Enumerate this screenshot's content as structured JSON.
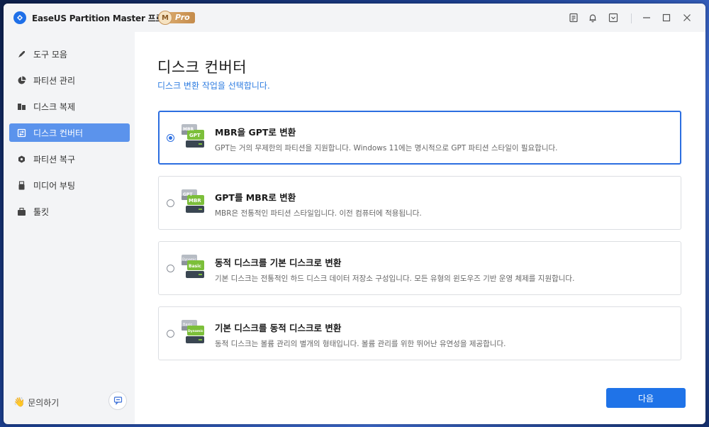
{
  "app": {
    "title": "EaseUS Partition Master 프로 버전",
    "badge_letter": "M",
    "badge_label": "Pro"
  },
  "titlebar_icons": [
    "notes-icon",
    "bell-icon",
    "dropdown-icon",
    "minimize-icon",
    "maximize-icon",
    "close-icon"
  ],
  "sidebar": {
    "items": [
      {
        "label": "도구 모음",
        "icon": "rocket-icon",
        "active": false
      },
      {
        "label": "파티션 관리",
        "icon": "pie-chart-icon",
        "active": false
      },
      {
        "label": "디스크 복제",
        "icon": "clone-icon",
        "active": false
      },
      {
        "label": "디스크 컨버터",
        "icon": "convert-icon",
        "active": true
      },
      {
        "label": "파티션 복구",
        "icon": "recovery-icon",
        "active": false
      },
      {
        "label": "미디어 부팅",
        "icon": "usb-icon",
        "active": false
      },
      {
        "label": "툴킷",
        "icon": "toolkit-icon",
        "active": false
      }
    ],
    "help_label": "문의하기"
  },
  "main": {
    "title": "디스크 컨버터",
    "subtitle": "디스크 변환 작업을 선택합니다.",
    "options": [
      {
        "title": "MBR을 GPT로 변환",
        "description": "GPT는 거의 무제한의 파티션을 지원합니다. Windows 11에는 명시적으로 GPT 파티션 스타일이 필요합니다.",
        "icon_top": "MBR",
        "icon_bottom": "GPT",
        "selected": true
      },
      {
        "title": "GPT를 MBR로 변환",
        "description": "MBR은 전통적인 파티션 스타일입니다. 이전 컴퓨터에 적용됩니다.",
        "icon_top": "GPT",
        "icon_bottom": "MBR",
        "selected": false
      },
      {
        "title": "동적 디스크를 기본 디스크로 변환",
        "description": "기본 디스크는 전통적인 하드 디스크 데이터 저장소 구성입니다. 모든 유형의 윈도우즈 기반 운영 체제를 지원합니다.",
        "icon_top": "Dynamic",
        "icon_bottom": "Basic",
        "selected": false
      },
      {
        "title": "기본 디스크를 동적 디스크로 변환",
        "description": "동적 디스크는 볼륨 관리의 별개의 형태입니다. 볼륨 관리를 위한 뛰어난 유연성을 제공합니다.",
        "icon_top": "Basic",
        "icon_bottom": "Dynamic",
        "selected": false
      }
    ],
    "next_label": "다음"
  },
  "colors": {
    "accent": "#1f73e8",
    "sidebar_active": "#5b93ec",
    "subtitle": "#2f7de1",
    "icon_green": "#7cbf3a"
  }
}
